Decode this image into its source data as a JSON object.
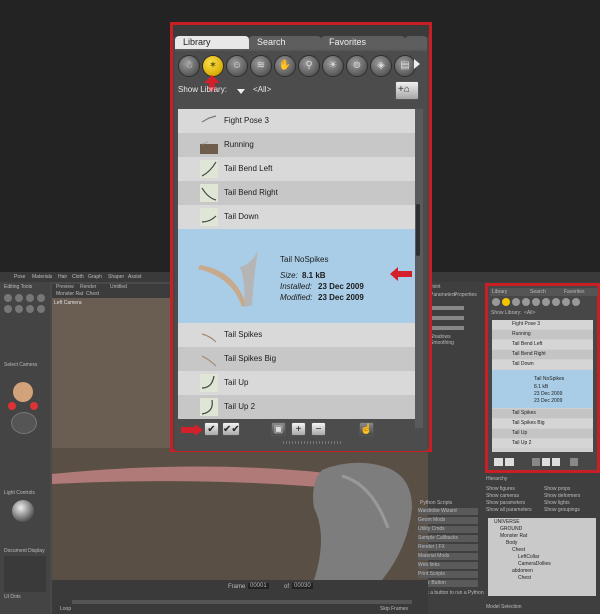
{
  "library": {
    "tabs": [
      "Library",
      "Search",
      "Favorites"
    ],
    "show_label": "Show Library:",
    "filter_value": "<All>",
    "items": [
      "Fight Pose 3",
      "Running",
      "Tail Bend Left",
      "Tail Bend Right",
      "Tail Down",
      "Tail NoSpikes",
      "Tail Spikes",
      "Tail Spikes Big",
      "Tail Up",
      "Tail Up 2"
    ],
    "selected": {
      "name": "Tail NoSpikes",
      "size_label": "Size:",
      "size": "8.1 kB",
      "installed_label": "Installed:",
      "installed": "23 Dec 2009",
      "modified_label": "Modified:",
      "modified": "23 Dec 2009"
    },
    "buttons": {
      "add": "+",
      "remove": "−"
    }
  },
  "background": {
    "menu": [
      "Pose",
      "Materials",
      "Hair",
      "Cloth",
      "Graph",
      "Shaper",
      "Assist"
    ],
    "viewport_tabs": [
      "Preview",
      "Render",
      "Untitled"
    ],
    "viewport_bar": [
      "Monster Rat",
      "Chest"
    ],
    "camera_label": "Left Camera",
    "left_panel": [
      "Editing Tools",
      "Select Camera",
      "Light Controls",
      "Document Display",
      "UI Dots"
    ],
    "frame_label": "Frame",
    "frame_value": "00001",
    "frame_total": "00030",
    "skip_label": "Skip Frames",
    "loop_label": "Loop",
    "right_small": [
      "Joint",
      "Parameters",
      "Properties",
      "Shadows",
      "Smoothing"
    ],
    "python_title": "Python Scripts",
    "python_items": [
      "Wardrobe Wizard",
      "Geom Mods",
      "Utility Cmds",
      "Sample Callbacks",
      "Render | FX",
      "Material Mods",
      "Web links",
      "Print Scripts",
      "Clear Button"
    ],
    "python_footer": "Click a button to run a Python script",
    "hierarchy_title": "Hierarchy",
    "hierarchy_options": [
      "Show figures",
      "Show props",
      "Show cameras",
      "Show deformers",
      "Show parameters",
      "Show lights",
      "Show all parameters",
      "Show groupings"
    ],
    "hierarchy_items": [
      "UNIVERSE",
      "GROUND",
      "Monster Rat",
      "Body",
      "Chest",
      "LeftCollar",
      "CameraDollies",
      "abdomen",
      "Chest"
    ],
    "model_selection": "Model Selection"
  },
  "colors": {
    "highlight_red": "#c81e24",
    "selection_blue": "#a9cde6",
    "accent_yellow": "#f2c500"
  }
}
